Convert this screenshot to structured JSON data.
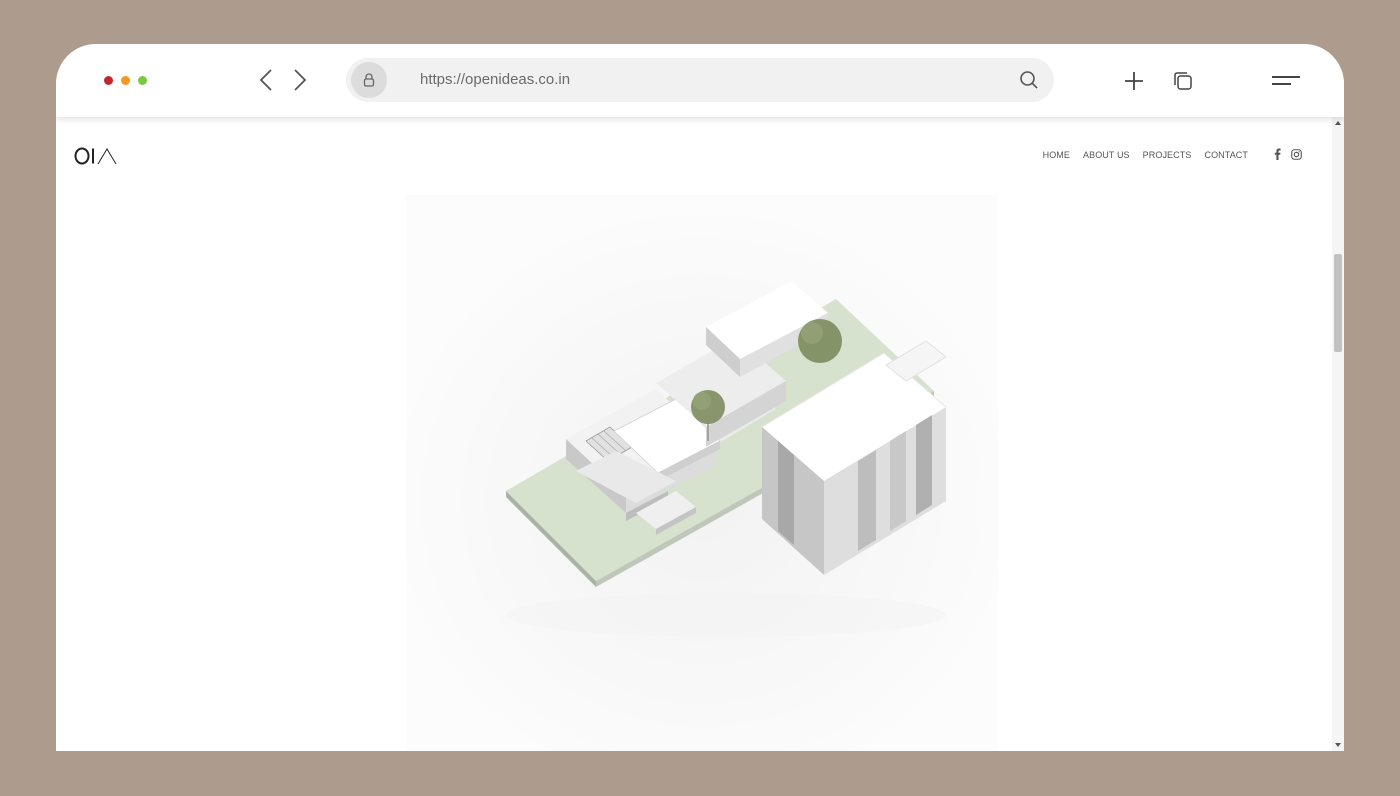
{
  "browser": {
    "url": "https://openideas.co.in",
    "traffic_colors": {
      "close": "#c1272d",
      "minimize": "#f39a1e",
      "maximize": "#7ac943"
    },
    "icons": {
      "back": "chevron-left",
      "forward": "chevron-right",
      "lock": "padlock",
      "search": "magnifier",
      "new_tab": "plus",
      "tabs": "stacked-squares",
      "menu": "two-lines"
    }
  },
  "site": {
    "logo_text": "OIA",
    "nav": [
      {
        "label": "HOME"
      },
      {
        "label": "ABOUT US"
      },
      {
        "label": "PROJECTS"
      },
      {
        "label": "CONTACT"
      }
    ],
    "social": [
      "facebook",
      "instagram"
    ]
  },
  "colors": {
    "backdrop": "#ad9b8e",
    "lawn": "#d6e2cd",
    "tree": "#7c8b5e"
  }
}
